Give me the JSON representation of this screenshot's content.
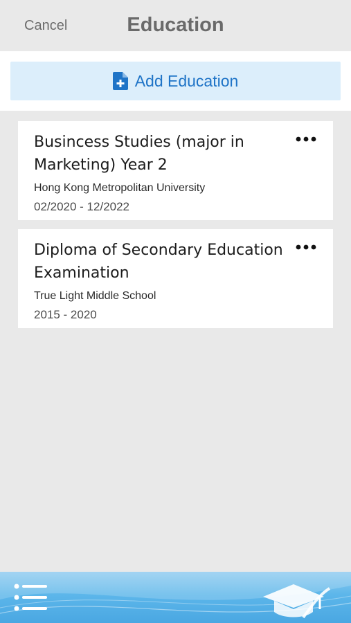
{
  "header": {
    "cancel_label": "Cancel",
    "title": "Education"
  },
  "add_button": {
    "label": "Add Education",
    "icon": "add-document-icon"
  },
  "education": [
    {
      "title_line1": "Busincess Studies (major in",
      "title_line2": "Marketing) Year 2",
      "school": "Hong Kong Metropolitan University",
      "dates": "02/2020 - 12/2022"
    },
    {
      "title_line1": "Diploma of Secondary Education",
      "title_line2": "Examination",
      "school": "True Light Middle School",
      "dates": "2015 - 2020"
    }
  ],
  "bottom_bar": {
    "menu_icon": "list-menu-icon",
    "logo_icon": "graduation-cap-logo-icon"
  },
  "colors": {
    "accent": "#1f74c7",
    "add_button_bg": "#dceefb",
    "background": "#e9e9e9",
    "bottom_bar": "#5cb6ea"
  }
}
